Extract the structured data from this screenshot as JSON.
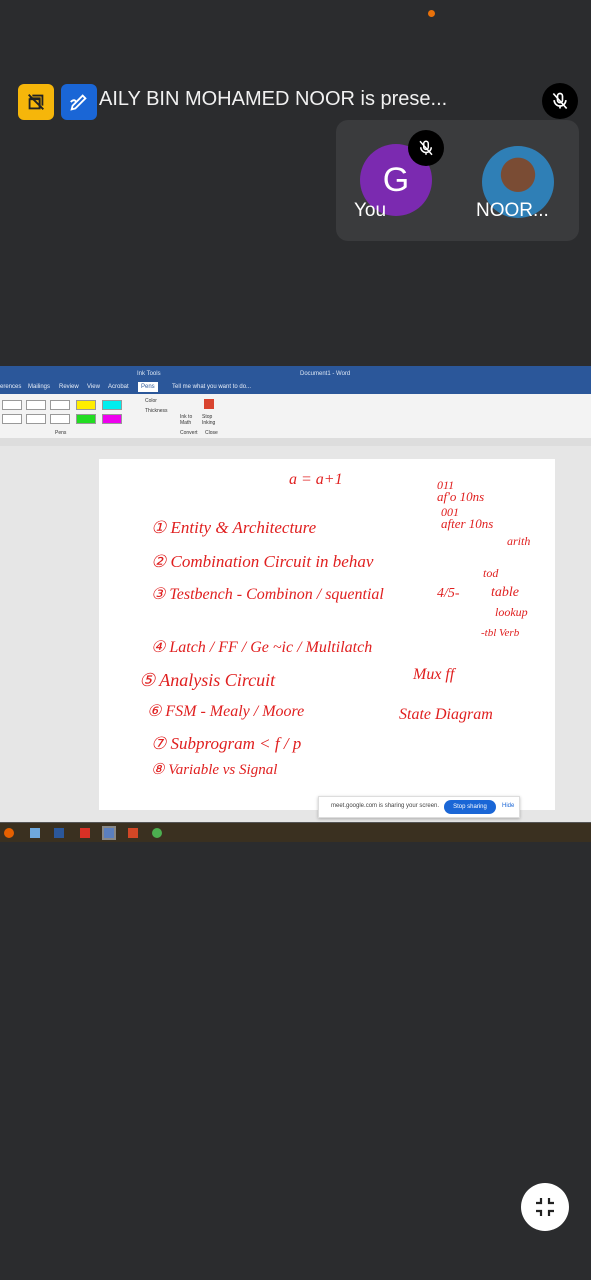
{
  "status": {
    "indicator_color": "#e8710a"
  },
  "presenter_bar": {
    "title": "AILY BIN MOHAMED NOOR is prese...",
    "layout_icon": "no-layout-icon",
    "annotate_icon": "annotate-pen-icon",
    "mic_icon": "mic-off-icon"
  },
  "participants": [
    {
      "name": "You",
      "avatar_letter": "G",
      "avatar_color": "#7b2ab0",
      "muted": true
    },
    {
      "name": "NOOR...",
      "avatar": "photo",
      "muted": false
    }
  ],
  "shared_screen": {
    "window_title": "Document1 - Word",
    "contextual_tab": "Ink Tools",
    "tabs": [
      "erences",
      "Mailings",
      "Review",
      "View",
      "Acrobat",
      "Pens"
    ],
    "active_tab": "Pens",
    "tell_me": "Tell me what you want to do...",
    "ribbon": {
      "group_pens": "Pens",
      "color_label": "Color",
      "thickness_label": "Thickness",
      "ink_to_math": "Ink to Math",
      "stop_inking": "Stop Inking",
      "group_convert": "Convert",
      "group_close": "Close"
    },
    "handwriting": {
      "line0": "a = a+1",
      "notes": [
        "011",
        "af'o 10ns",
        "001",
        "after 10ns",
        "arith",
        "tod",
        "table",
        "lookup",
        "-tbl Verb"
      ],
      "items": [
        "① Entity & Architecture",
        "② Combination Circuit in behav",
        "③ Testbench - Combinon / squential",
        "④ Latch / FF / Ge ~ic / Multilatch",
        "⑤ Analysis Circuit",
        "⑥ FSM - Mealy / Moore",
        "⑦ Subprogram < f / p",
        "⑧ Variable vs Signal"
      ],
      "side": [
        "4/5-",
        "Mux ff",
        "State Diagram"
      ]
    },
    "share_banner": {
      "text": "meet.google.com is sharing your screen.",
      "stop_button": "Stop sharing",
      "hide_link": "Hide"
    },
    "taskbar_icons": [
      "firefox-icon",
      "files-icon",
      "word-icon",
      "acrobat-icon",
      "word-active-icon",
      "powerpoint-icon",
      "chrome-icon"
    ]
  },
  "controls": {
    "exit_fullscreen_icon": "exit-fullscreen-icon"
  },
  "colors": {
    "background": "#2b2c2e",
    "ink": "#e02020",
    "word_blue": "#2b579a",
    "meet_blue": "#1a66d6"
  }
}
